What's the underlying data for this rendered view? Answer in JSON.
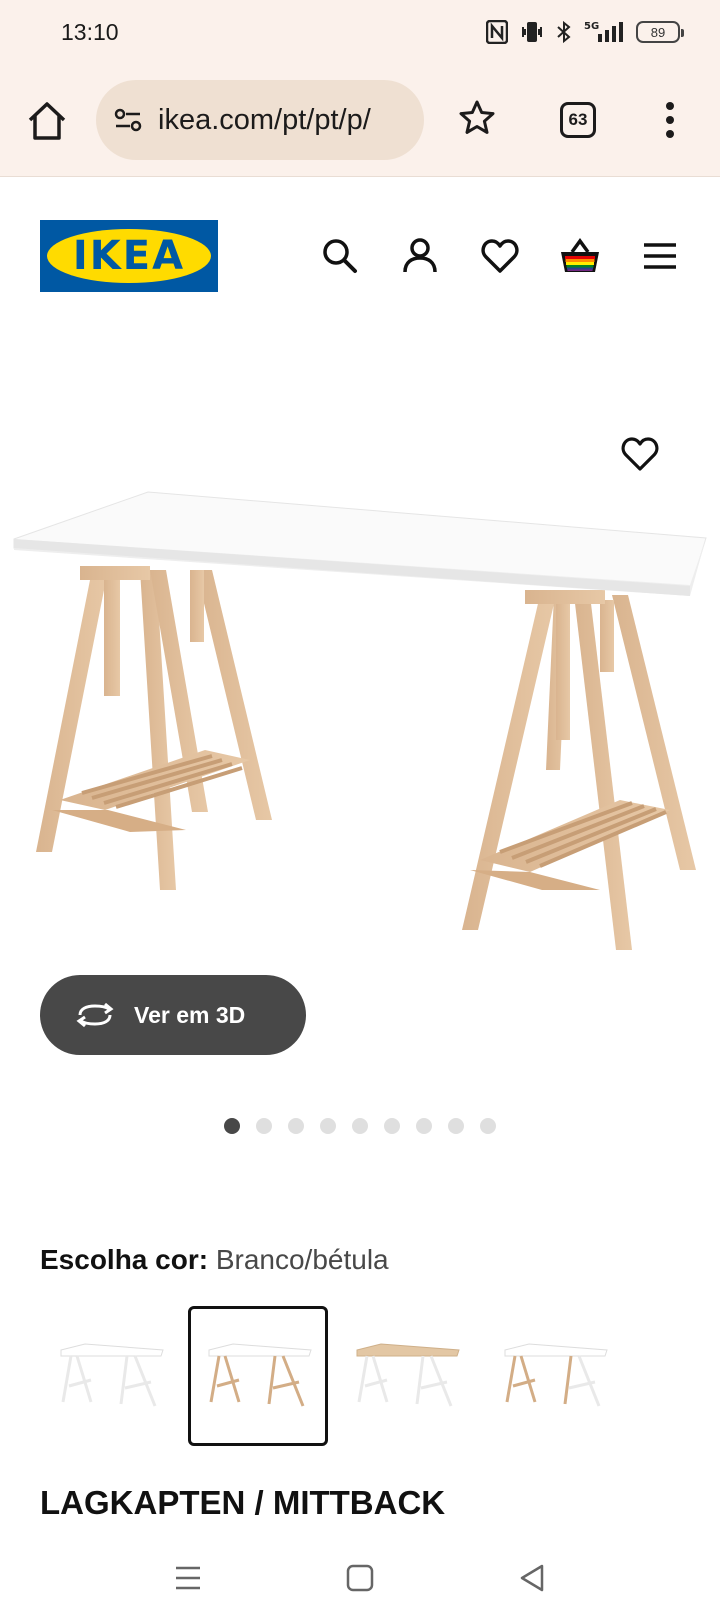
{
  "status_bar": {
    "time": "13:10",
    "battery": "89",
    "icons": [
      "nfc-icon",
      "vibrate-icon",
      "bluetooth-icon",
      "5g-signal-icon",
      "battery-icon"
    ]
  },
  "browser": {
    "url": "ikea.com/pt/pt/p/",
    "tab_count": "63"
  },
  "header": {
    "logo_text": "IKEA",
    "colors": {
      "brand_blue": "#0058a3",
      "brand_yellow": "#ffdb00"
    }
  },
  "product": {
    "view_3d_label": "Ver em 3D",
    "image_count": 9,
    "active_image": 1,
    "color_label": "Escolha cor:",
    "color_value": "Branco/bétula",
    "swatches": [
      "branco",
      "branco/bétula",
      "bétula/branco",
      "branco/bétula-2"
    ],
    "selected_swatch": 2,
    "name": "LAGKAPTEN / MITTBACK"
  }
}
